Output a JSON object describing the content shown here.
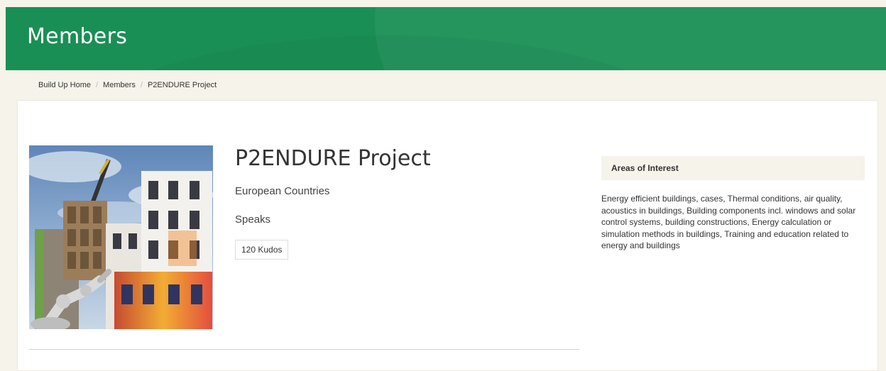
{
  "header": {
    "title": "Members"
  },
  "breadcrumb": [
    {
      "label": "Build Up Home"
    },
    {
      "label": "Members"
    },
    {
      "label": "P2ENDURE Project"
    }
  ],
  "profile": {
    "name": "P2ENDURE Project",
    "country": "European Countries",
    "speaks_label": "Speaks",
    "kudos": "120 Kudos"
  },
  "areas_of_interest": {
    "heading": "Areas of Interest",
    "text": "Energy efficient buildings, cases, Thermal conditions, air quality, acoustics in buildings, Building components incl. windows and solar control systems, building constructions, Energy calculation or simulation methods in buildings, Training and education related to energy and buildings"
  },
  "colors": {
    "header_green": "#1a8f55",
    "page_bg": "#f5f3ea"
  }
}
